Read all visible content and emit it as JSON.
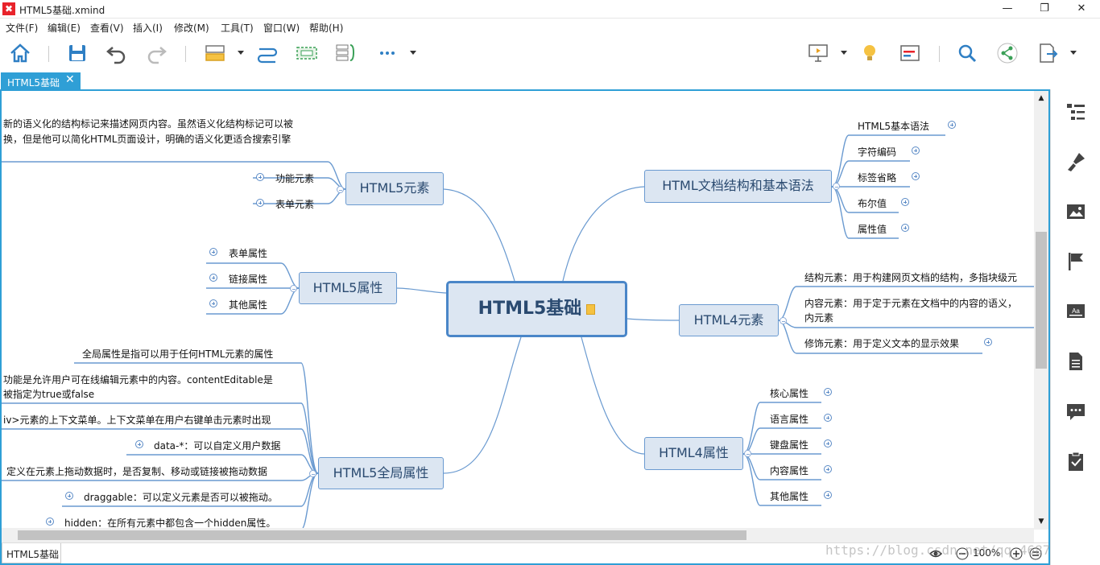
{
  "window": {
    "title": "HTML5基础.xmind",
    "app_logo": "✖",
    "controls": [
      "—",
      "❐",
      "✕"
    ]
  },
  "menu": [
    "文件(F)",
    "编辑(E)",
    "查看(V)",
    "插入(I)",
    "修改(M)",
    "工具(T)",
    "窗口(W)",
    "帮助(H)"
  ],
  "toolbar": {
    "icons": [
      "home-icon",
      "save-icon",
      "undo-icon",
      "redo-icon",
      "topic-style-icon",
      "relationship-icon",
      "boundary-icon",
      "summary-icon",
      "more-icon",
      "presentation-icon",
      "idea-icon",
      "gantt-icon",
      "search-icon",
      "share-icon",
      "export-icon"
    ]
  },
  "tab": {
    "label": "HTML5基础",
    "close": "✕"
  },
  "mindmap": {
    "central": "HTML5基础",
    "left_branches": [
      {
        "label": "HTML5元素",
        "children": [
          "功能元素",
          "表单元素"
        ]
      },
      {
        "label": "HTML5属性",
        "children": [
          "表单属性",
          "链接属性",
          "其他属性"
        ]
      },
      {
        "label": "HTML5全局属性",
        "children": [
          "全局属性是指可以用于任何HTML元素的属性",
          "功能是允许用户可在线编辑元素中的内容。contentEditable是",
          "被指定为true或false",
          "iv>元素的上下文菜单。上下文菜单在用户右键单击元素时出现",
          "data-*：可以自定义用户数据",
          "定义在元素上拖动数据时，是否复制、移动或链接被拖动数据",
          "draggable：可以定义元素是否可以被拖动。",
          "hidden：在所有元素中都包含一个hidden属性。"
        ]
      }
    ],
    "left_top_text": [
      "新的语义化的结构标记来描述网页内容。虽然语义化结构标记可以被",
      "换，但是他可以简化HTML页面设计，明确的语义化更适合搜索引擎"
    ],
    "right_branches": [
      {
        "label": "HTML文档结构和基本语法",
        "children": [
          "HTML5基本语法",
          "字符编码",
          "标签省略",
          "布尔值",
          "属性值"
        ]
      },
      {
        "label": "HTML4元素",
        "children": [
          "结构元素：用于构建网页文档的结构，多指块级元",
          "内容元素：用于定于元素在文档中的内容的语义，",
          "内元素",
          "修饰元素：用于定义文本的显示效果"
        ]
      },
      {
        "label": "HTML4属性",
        "children": [
          "核心属性",
          "语言属性",
          "键盘属性",
          "内容属性",
          "其他属性"
        ]
      }
    ]
  },
  "statusbar": {
    "sheet": "HTML5基础",
    "zoom": "100%",
    "watermark": "https://blog.csdn.net/qq_46872792"
  },
  "sidebar": {
    "icons": [
      "outline-icon",
      "format-icon",
      "image-icon",
      "marker-icon",
      "label-icon",
      "notes-icon",
      "comments-icon",
      "task-icon"
    ]
  },
  "colors": {
    "accent": "#2f9fd6",
    "topic_fill": "#dce6f2",
    "topic_border": "#4a86c8",
    "branch_line": "#6a9ad0"
  }
}
